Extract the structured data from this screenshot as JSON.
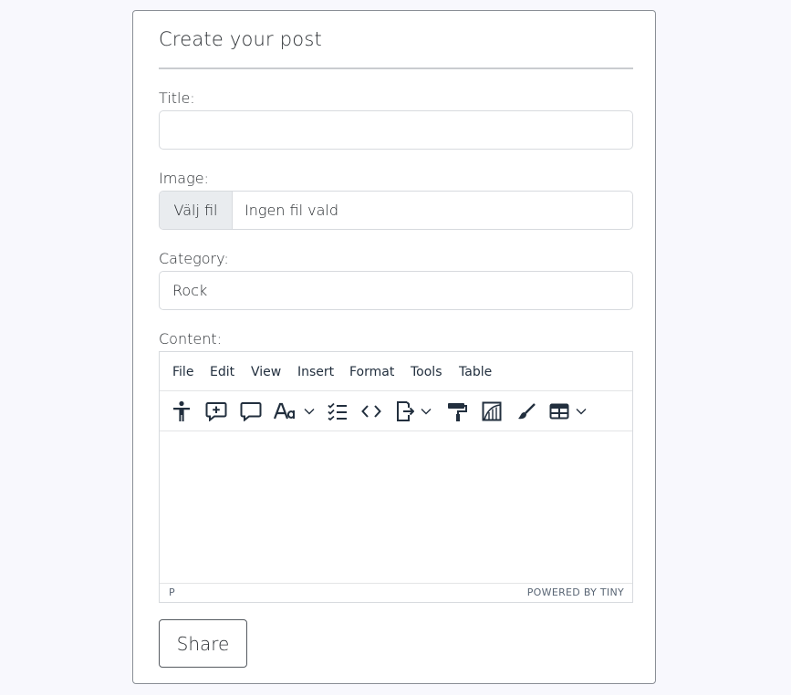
{
  "form": {
    "heading": "Create your post",
    "title_label": "Title:",
    "title_value": "",
    "image_label": "Image:",
    "file_button": "Välj fil",
    "file_status": "Ingen fil vald",
    "category_label": "Category:",
    "category_value": "Rock",
    "content_label": "Content:",
    "submit_label": "Share"
  },
  "editor": {
    "menu": [
      "File",
      "Edit",
      "View",
      "Insert",
      "Format",
      "Tools",
      "Table"
    ],
    "toolbar_icons": [
      "accessibility-icon",
      "add-comment-icon",
      "comment-icon",
      "font-family-icon",
      "checklist-icon",
      "code-icon",
      "export-icon",
      "format-painter-icon",
      "image-edit-icon",
      "brush-icon",
      "table-icon"
    ],
    "status_path": "P",
    "branding": "POWERED BY TINY"
  }
}
